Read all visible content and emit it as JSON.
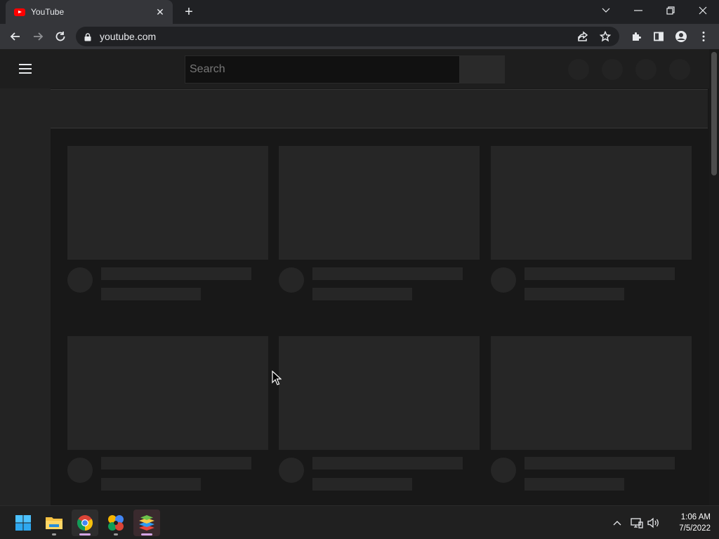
{
  "browser": {
    "tab": {
      "title": "YouTube",
      "favicon": "youtube-icon",
      "close_glyph": "✕"
    },
    "new_tab_glyph": "+",
    "address": {
      "url": "youtube.com"
    },
    "window_controls": [
      "tab-search",
      "minimize",
      "restore",
      "close"
    ],
    "toolbar_icons": [
      "share-icon",
      "star-icon",
      "extensions-icon",
      "side-panel-icon",
      "profile-icon",
      "menu-icon"
    ]
  },
  "youtube": {
    "search": {
      "placeholder": "Search"
    },
    "loading_placeholders": true
  },
  "taskbar": {
    "apps": [
      "windows-start-icon",
      "file-explorer-icon",
      "chrome-icon",
      "pinwheel-app-icon",
      "bluestacks-icon"
    ],
    "clock": {
      "time": "1:06 AM",
      "date": "7/5/2022"
    }
  },
  "colors": {
    "youtube_red": "#ff0000",
    "page_bg": "#181818",
    "placeholder": "#262626"
  }
}
